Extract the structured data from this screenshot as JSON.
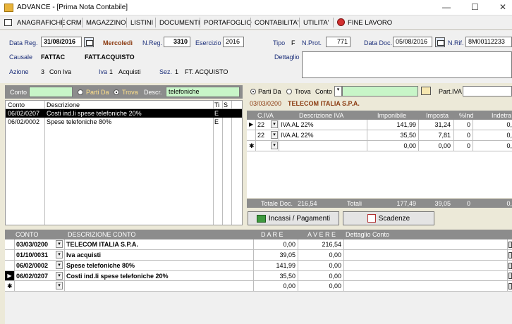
{
  "window": {
    "title": "ADVANCE - [Prima Nota Contabile]"
  },
  "menu": [
    "ANAGRAFICHE",
    "CRM",
    "MAGAZZINO",
    "LISTINI",
    "DOCUMENTI",
    "PORTAFOGLIO",
    "CONTABILITA'",
    "UTILITA'",
    "FINE LAVORO"
  ],
  "header": {
    "data_reg_label": "Data Reg.",
    "data_reg": "31/08/2016",
    "weekday": "Mercoledì",
    "nreg_label": "N.Reg.",
    "nreg": "3310",
    "esercizio_label": "Esercizio",
    "esercizio": "2016",
    "tipo_label": "Tipo",
    "tipo": "F",
    "nprot_label": "N.Prot.",
    "nprot": "771",
    "data_doc_label": "Data Doc.",
    "data_doc": "05/08/2016",
    "nrif_label": "N.Rif.",
    "nrif": "8M00112233",
    "causale_label": "Causale",
    "causale_code": "FATTAC",
    "causale_desc": "FATT.ACQUISTO",
    "dettaglio_label": "Dettaglio",
    "azione_label": "Azione",
    "azione_code": "3",
    "azione_desc": "Con Iva",
    "iva_label": "Iva",
    "iva_code": "1",
    "iva_desc": "Acquisti",
    "sez_label": "Sez.",
    "sez_code": "1",
    "sez_desc": "FT. ACQUISTO"
  },
  "search": {
    "conto_label": "Conto",
    "parti_da": "Parti Da",
    "trova": "Trova",
    "descr_label": "Descr.",
    "descr_value": "telefoniche",
    "cols": [
      "Conto",
      "Descrizione",
      "Ti",
      "S"
    ],
    "rows": [
      {
        "conto": "06/02/0207",
        "desc": "Costi ind.li spese telefoniche 20%",
        "ti": "E",
        "selected": true
      },
      {
        "conto": "06/02/0002",
        "desc": "Spese telefoniche 80%",
        "ti": "E",
        "selected": false
      }
    ]
  },
  "iva_panel": {
    "parti_da": "Parti Da",
    "trova": "Trova",
    "conto_label": "Conto",
    "partiva_label": "Part.IVA",
    "supplier_code": "03/03/0200",
    "supplier_name": "TELECOM ITALIA S.P.A.",
    "cols": [
      "C.IVA",
      "Descrizione IVA",
      "Imponibile",
      "Imposta",
      "%Ind",
      "Indetra"
    ],
    "rows": [
      {
        "civa": "22",
        "desc": "IVA AL 22%",
        "imponibile": "141,99",
        "imposta": "31,24",
        "ind": "0",
        "indetra": "0,"
      },
      {
        "civa": "22",
        "desc": "IVA AL 22%",
        "imponibile": "35,50",
        "imposta": "7,81",
        "ind": "0",
        "indetra": "0,"
      },
      {
        "civa": "",
        "desc": "",
        "imponibile": "0,00",
        "imposta": "0,00",
        "ind": "0",
        "indetra": "0,"
      }
    ],
    "totale_doc_label": "Totale Doc.",
    "totale_doc": "216,54",
    "totali_label": "Totali",
    "tot_imponibile": "177,49",
    "tot_imposta": "39,05",
    "tot_ind": "0",
    "tot_indetra": "0,"
  },
  "buttons": {
    "incassi": "Incassi / Pagamenti",
    "scadenze": "Scadenze"
  },
  "ledger": {
    "cols": [
      "CONTO",
      "DESCRIZIONE CONTO",
      "D A R E",
      "A V E R E",
      "Dettaglio Conto"
    ],
    "rows": [
      {
        "conto": "03/03/0200",
        "desc": "TELECOM ITALIA S.P.A.",
        "dare": "0,00",
        "avere": "216,54",
        "marker": ""
      },
      {
        "conto": "01/10/0031",
        "desc": "Iva acquisti",
        "dare": "39,05",
        "avere": "0,00",
        "marker": ""
      },
      {
        "conto": "06/02/0002",
        "desc": "Spese telefoniche 80%",
        "dare": "141,99",
        "avere": "0,00",
        "marker": ""
      },
      {
        "conto": "06/02/0207",
        "desc": "Costi ind.li spese telefoniche 20%",
        "dare": "35,50",
        "avere": "0,00",
        "marker": "▶"
      },
      {
        "conto": "",
        "desc": "",
        "dare": "0,00",
        "avere": "0,00",
        "marker": "✱"
      }
    ]
  },
  "colors": {
    "green": "#c8f5c8",
    "brown": "#8b3a10",
    "blue": "#1c2f7a",
    "selection": "#000000"
  }
}
